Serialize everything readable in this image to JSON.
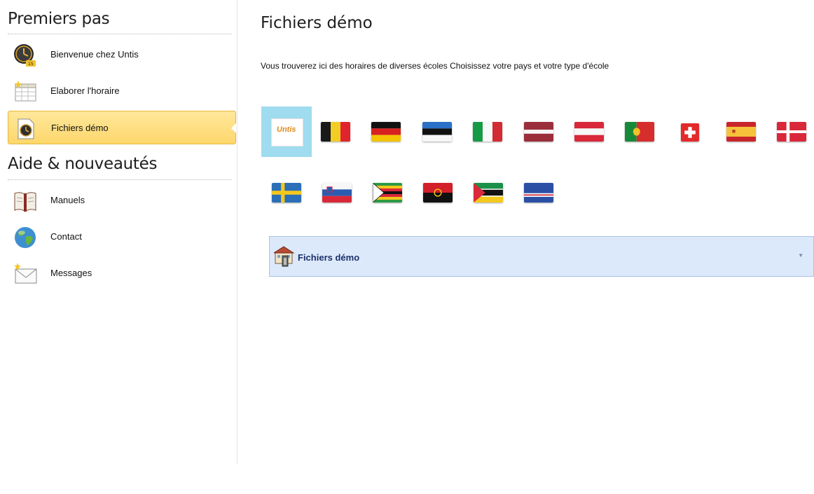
{
  "sidebar": {
    "section1_title": "Premiers pas",
    "section2_title": "Aide & nouveautés",
    "items": [
      {
        "label": "Bienvenue chez Untis",
        "icon": "clock-icon"
      },
      {
        "label": "Elaborer l'horaire",
        "icon": "timetable-icon"
      },
      {
        "label": "Fichiers démo",
        "icon": "demo-file-icon",
        "active": true
      },
      {
        "label": "Manuels",
        "icon": "book-icon"
      },
      {
        "label": "Contact",
        "icon": "globe-icon"
      },
      {
        "label": "Messages",
        "icon": "envelope-icon"
      }
    ]
  },
  "main": {
    "title": "Fichiers démo",
    "description": "Vous trouverez ici des horaires de diverses écoles Choisissez votre pays et votre type d'école",
    "logo_text": "Untis",
    "flags_row1": [
      "untis-logo",
      "belgium-flag",
      "germany-flag",
      "estonia-flag",
      "italy-flag",
      "latvia-flag",
      "austria-flag",
      "portugal-flag",
      "switzerland-flag",
      "spain-flag",
      "denmark-flag"
    ],
    "flags_row2": [
      "sweden-flag",
      "slovenia-flag",
      "zimbabwe-flag",
      "angola-flag",
      "mozambique-flag",
      "cape-verde-flag"
    ],
    "dropdown_label": "Fichiers démo"
  },
  "colors": {
    "active_bg": "#fdd76c",
    "active_border": "#e5b83b",
    "selected_tile": "#9fdcef",
    "dropdown_bg": "#dce9fb",
    "dropdown_border": "#a9c1e8"
  }
}
